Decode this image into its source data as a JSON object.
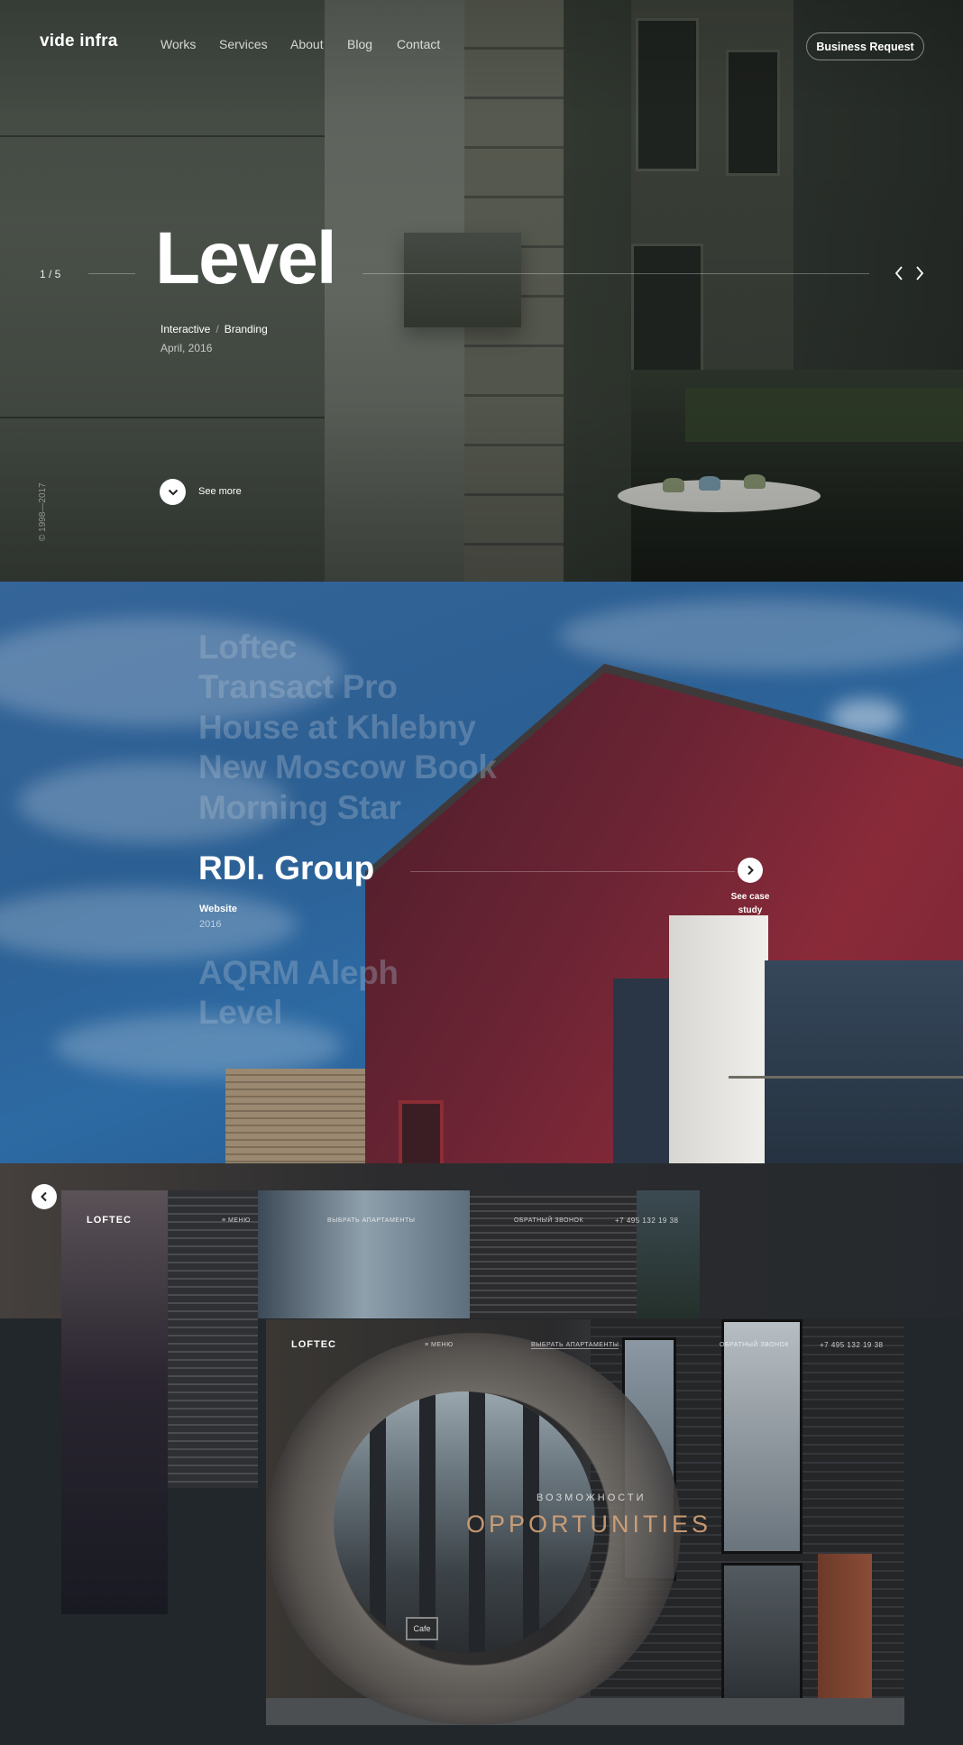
{
  "header": {
    "logo": "vide infra",
    "nav": [
      "Works",
      "Services",
      "About",
      "Blog",
      "Contact"
    ],
    "cta": "Business Request"
  },
  "hero": {
    "counter": "1 / 5",
    "title": "Level",
    "tags": [
      "Interactive",
      "Branding"
    ],
    "date": "April, 2016",
    "see_more": "See more",
    "copyright": "© 1998—2017"
  },
  "works": {
    "list_above": [
      "Loftec",
      "Transact Pro",
      "House at Khlebny",
      "New Moscow Book",
      "Morning Star"
    ],
    "active": {
      "title": "RDI. Group",
      "type": "Website",
      "year": "2016",
      "case_label_line1": "See case",
      "case_label_line2": "study"
    },
    "list_below": [
      "AQRM Aleph",
      "Level"
    ]
  },
  "case_preview": {
    "top": {
      "logo": "LOFTEC",
      "menu": "МЕНЮ",
      "select": "ВЫБРАТЬ АПАРТАМЕНТЫ",
      "callback": "ОБРАТНЫЙ ЗВОНОК",
      "phone": "+7 495 132 19 38"
    },
    "bottom": {
      "logo": "LOFTEC",
      "menu": "МЕНЮ",
      "select": "ВЫБРАТЬ АПАРТАМЕНТЫ",
      "callback": "ОБРАТНЫЙ ЗВОНОК",
      "phone": "+7 495 132 19 38",
      "subtitle": "ВОЗМОЖНОСТИ",
      "title": "OPPORTUNITIES",
      "sign": "Cafe"
    }
  },
  "colors": {
    "accent_copper": "#d6a478",
    "sky_blue": "#2d6aa3",
    "brick_red": "#8a2a39"
  }
}
